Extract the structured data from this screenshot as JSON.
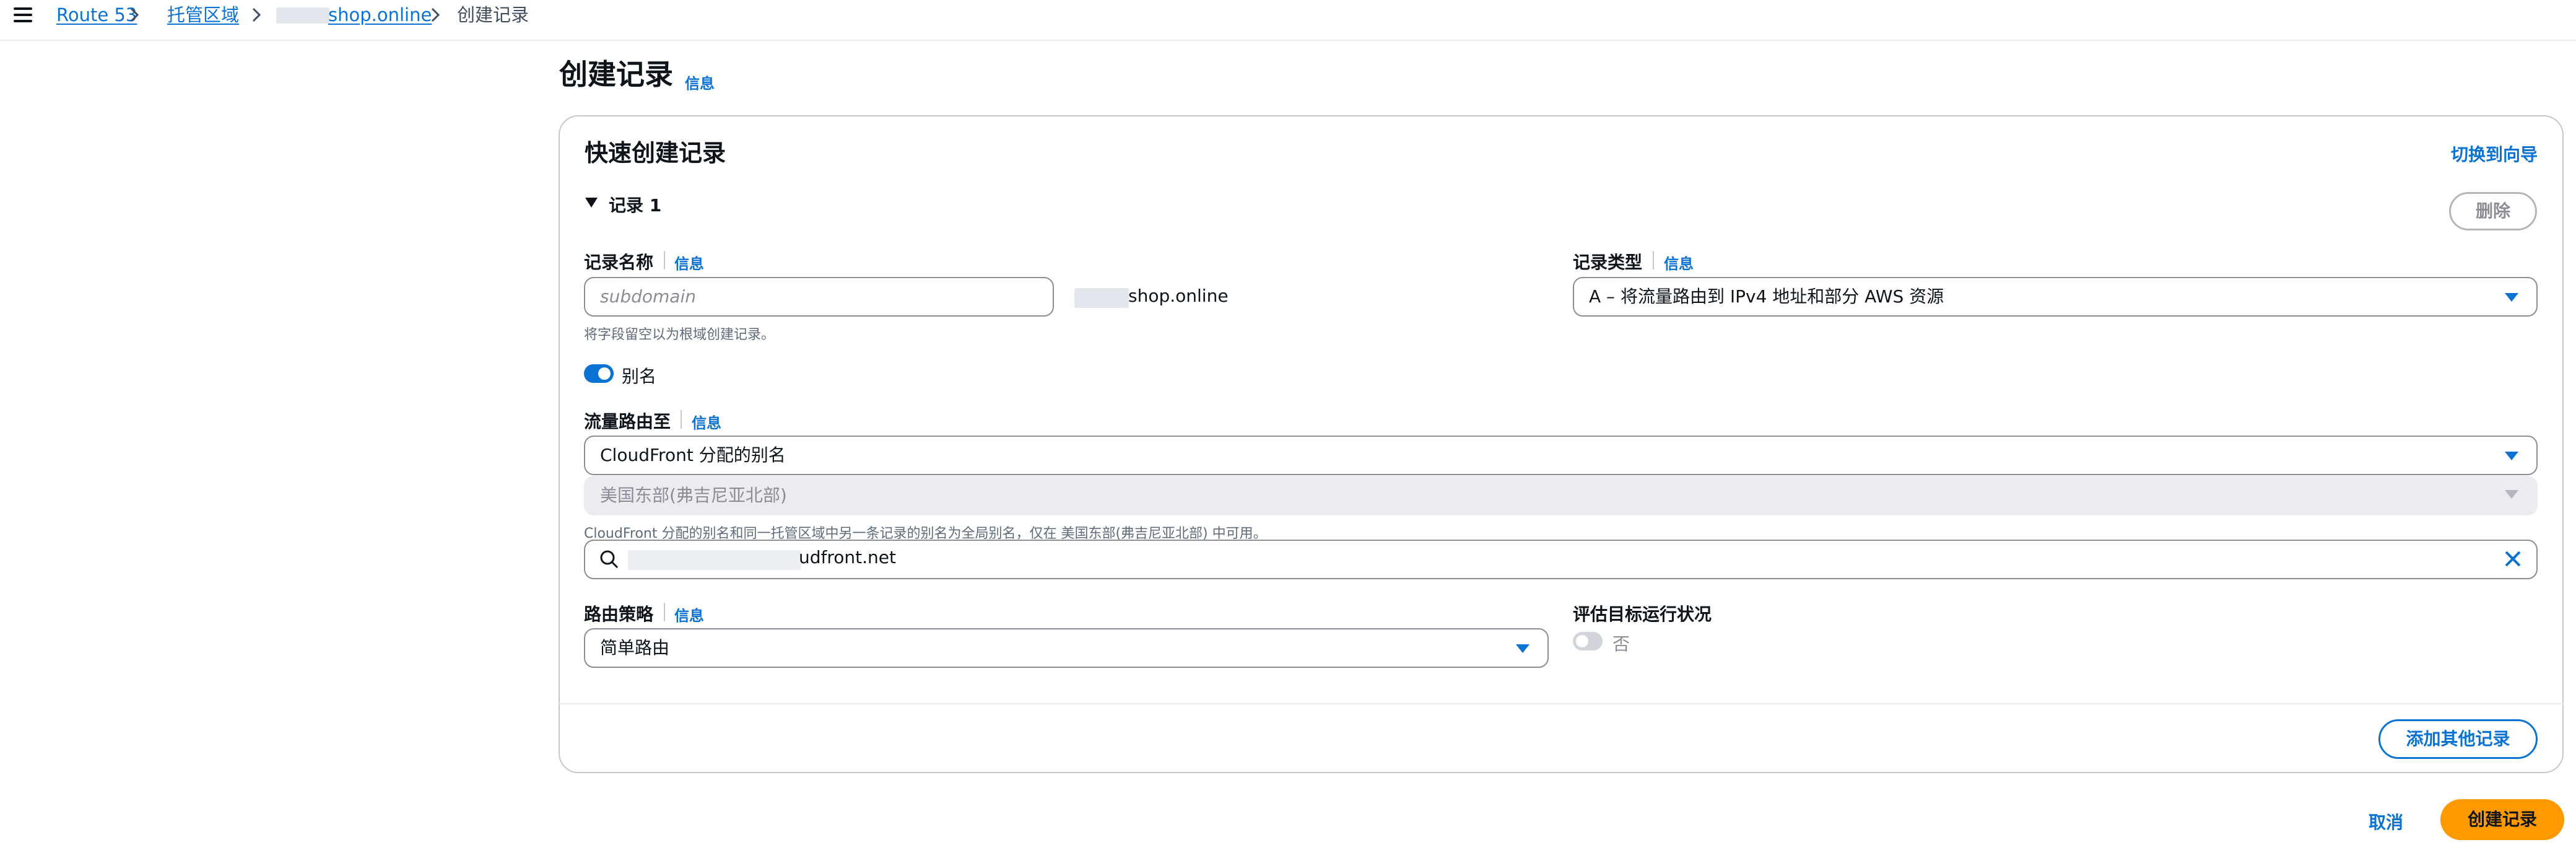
{
  "breadcrumb": {
    "items": [
      "Route 53",
      "托管区域",
      "shop.online",
      "创建记录"
    ]
  },
  "header": {
    "title": "创建记录",
    "info": "信息"
  },
  "quick_create": {
    "title": "快速创建记录",
    "switch_to_wizard": "切换到向导",
    "record_section": "记录 1",
    "delete_button": "删除"
  },
  "record_name": {
    "label": "记录名称",
    "info": "信息",
    "placeholder": "subdomain",
    "domain_suffix": "shop.online",
    "hint": "将字段留空以为根域创建记录。"
  },
  "record_type": {
    "label": "记录类型",
    "info": "信息",
    "value": "A – 将流量路由到 IPv4 地址和部分 AWS 资源"
  },
  "alias": {
    "label": "别名",
    "enabled": true
  },
  "route_traffic_to": {
    "label": "流量路由至",
    "info": "信息",
    "endpoint_value": "CloudFront 分配的别名",
    "region_value": "美国东部(弗吉尼亚北部)",
    "hint": "CloudFront 分配的别名和同一托管区域中另一条记录的别名为全局别名，仅在 美国东部(弗吉尼亚北部) 中可用。",
    "target_value": "udfront.net"
  },
  "routing_policy": {
    "label": "路由策略",
    "info": "信息",
    "value": "简单路由"
  },
  "evaluate_health": {
    "label": "评估目标运行状况",
    "value": "否",
    "enabled": false
  },
  "footer": {
    "add_another_record": "添加其他记录",
    "cancel": "取消",
    "create_records": "创建记录"
  },
  "colors": {
    "link": "#0972d3",
    "primary_button": "#ff9900",
    "text": "#0f141a"
  }
}
